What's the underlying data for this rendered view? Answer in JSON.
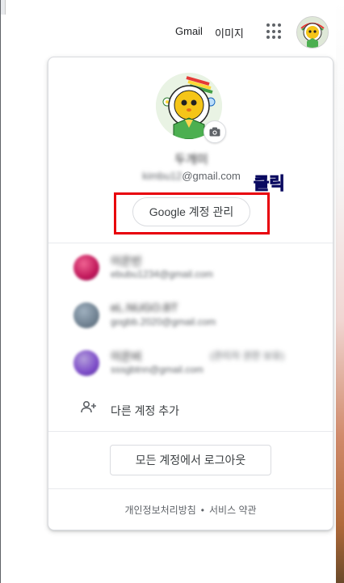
{
  "topbar": {
    "gmail_label": "Gmail",
    "images_label": "이미지",
    "apps_icon": "apps-grid-icon"
  },
  "panel": {
    "profile_name": "두개미",
    "profile_email_blurred": "kimbu12",
    "profile_email_suffix": "@gmail.com",
    "manage_button": "Google 계정 관리",
    "annotation": "클릭",
    "accounts": [
      {
        "name": "이은빈",
        "email": "ebubu1234@gmail.com",
        "extra": "",
        "color": "#c0185a"
      },
      {
        "name": "eL.NUGO.BT",
        "email": "gogbb.2020@gmail.com",
        "extra": "",
        "color": "#6f8191"
      },
      {
        "name": "이은비",
        "email": "sssgbtnn@gmail.com",
        "extra": "(관리자 권한 보유)",
        "color": "#7c4bc8"
      }
    ],
    "add_account_label": "다른 계정 추가",
    "signout_label": "모든 계정에서 로그아웃",
    "footer": {
      "privacy": "개인정보처리방침",
      "separator": "•",
      "terms": "서비스 약관"
    }
  },
  "colors": {
    "highlight": "#e8000b",
    "annotation": "#1a3cff",
    "border": "#dadce0"
  }
}
